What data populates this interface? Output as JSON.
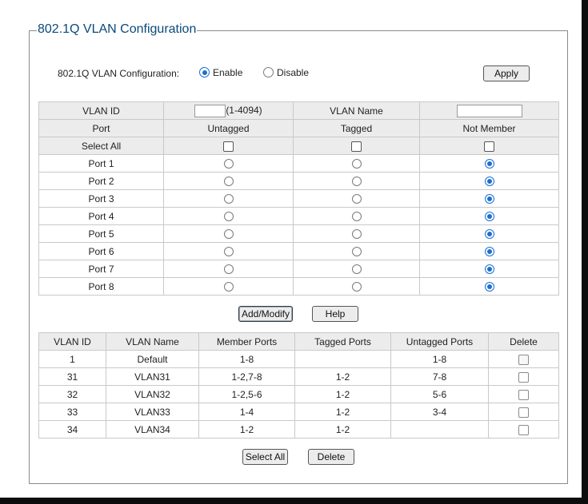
{
  "legend": "802.1Q VLAN Configuration",
  "config": {
    "label": "802.1Q VLAN Configuration:",
    "enable_label": "Enable",
    "disable_label": "Disable",
    "selected": "enable",
    "apply_label": "Apply"
  },
  "vlan_form": {
    "vlan_id_label": "VLAN ID",
    "vlan_id_value": "",
    "vlan_id_range": "(1-4094)",
    "vlan_name_label": "VLAN Name",
    "vlan_name_value": "",
    "headers": [
      "Port",
      "Untagged",
      "Tagged",
      "Not Member"
    ],
    "select_all_label": "Select All",
    "ports": [
      {
        "name": "Port 1",
        "selected": "not_member"
      },
      {
        "name": "Port 2",
        "selected": "not_member"
      },
      {
        "name": "Port 3",
        "selected": "not_member"
      },
      {
        "name": "Port 4",
        "selected": "not_member"
      },
      {
        "name": "Port 5",
        "selected": "not_member"
      },
      {
        "name": "Port 6",
        "selected": "not_member"
      },
      {
        "name": "Port 7",
        "selected": "not_member"
      },
      {
        "name": "Port 8",
        "selected": "not_member"
      }
    ]
  },
  "actions": {
    "add_modify_label": "Add/Modify",
    "help_label": "Help"
  },
  "vlan_table": {
    "headers": [
      "VLAN ID",
      "VLAN Name",
      "Member Ports",
      "Tagged Ports",
      "Untagged Ports",
      "Delete"
    ],
    "rows": [
      {
        "id": "1",
        "name": "Default",
        "members": "1-8",
        "tagged": "",
        "untagged": "1-8",
        "deletable": false
      },
      {
        "id": "31",
        "name": "VLAN31",
        "members": "1-2,7-8",
        "tagged": "1-2",
        "untagged": "7-8",
        "deletable": true
      },
      {
        "id": "32",
        "name": "VLAN32",
        "members": "1-2,5-6",
        "tagged": "1-2",
        "untagged": "5-6",
        "deletable": true
      },
      {
        "id": "33",
        "name": "VLAN33",
        "members": "1-4",
        "tagged": "1-2",
        "untagged": "3-4",
        "deletable": true
      },
      {
        "id": "34",
        "name": "VLAN34",
        "members": "1-2",
        "tagged": "1-2",
        "untagged": "",
        "deletable": true
      }
    ]
  },
  "bottom": {
    "select_all_label": "Select All",
    "delete_label": "Delete"
  },
  "colors": {
    "legend": "#0a4a7a",
    "radio_selected": "#1a6fd1",
    "header_bg": "#ececec",
    "border": "#c9c9c9",
    "frame": "#0c0c0c"
  }
}
